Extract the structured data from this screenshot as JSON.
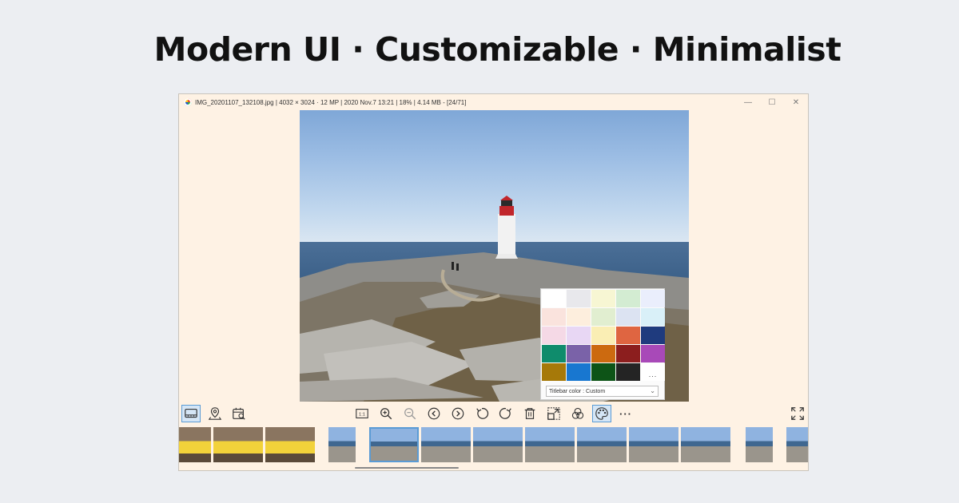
{
  "headline": "Modern UI · Customizable · Minimalist",
  "window": {
    "title": "IMG_20201107_132108.jpg  |  4032 × 3024  ·  12 MP  |  2020 Nov.7 13:21  |  18%  |  4.14 MB  -  [24/71]",
    "controls": {
      "minimize": "—",
      "maximize": "☐",
      "close": "✕"
    }
  },
  "palette": {
    "swatches": [
      "#ffffff",
      "#e8e8ec",
      "#f7f6d3",
      "#d3ecd2",
      "#eaeefc",
      "#fae3dd",
      "#fdeedd",
      "#e1eed0",
      "#dce3f2",
      "#d9f0f8",
      "#f5d9e6",
      "#e8d7f4",
      "#faeeb4",
      "#df6541",
      "#1f3b7e",
      "#0f8c6c",
      "#7a62a8",
      "#cc6a10",
      "#8c1e1e",
      "#a849b8",
      "#a67909",
      "#1877d0",
      "#0d5417",
      "#242424",
      "#ffffff"
    ],
    "more_label": "...",
    "select_value": "Titlebar color : Custom"
  },
  "toolbar": {
    "left": [
      "gallery-icon",
      "location-pin-icon",
      "calendar-search-icon"
    ],
    "center": [
      "actual-size-icon",
      "zoom-in-icon",
      "zoom-out-icon",
      "previous-icon",
      "next-icon",
      "rotate-left-icon",
      "rotate-right-icon",
      "delete-icon",
      "crop-icon",
      "color-adjust-icon",
      "palette-icon",
      "more-icon"
    ],
    "actual_size_label": "1:1",
    "more_label": "···",
    "right": [
      "fullscreen-icon"
    ],
    "accent": "#5a9bd5"
  },
  "filmstrip": {
    "selected_index": 4
  }
}
